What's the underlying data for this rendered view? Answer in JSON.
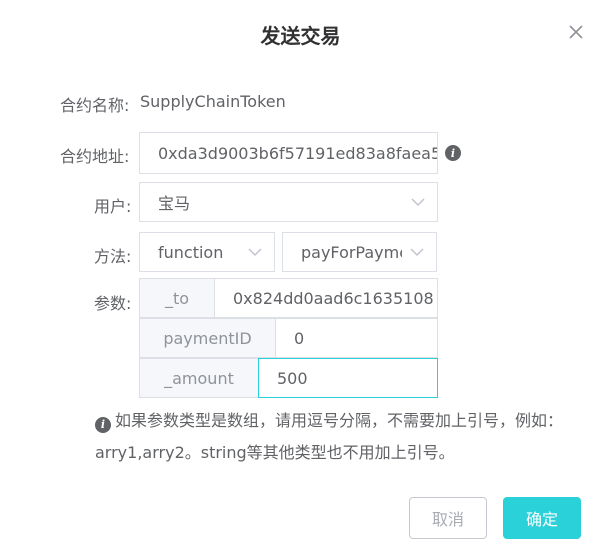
{
  "dialog": {
    "title": "发送交易"
  },
  "contract_name": {
    "label": "合约名称:",
    "value": "SupplyChainToken"
  },
  "contract_address": {
    "label": "合约地址:",
    "value": "0xda3d9003b6f57191ed83a8faea5"
  },
  "user": {
    "label": "用户:",
    "value": "宝马"
  },
  "method": {
    "label": "方法:",
    "type_value": "function",
    "name_value": "payForPayment"
  },
  "params": {
    "label": "参数:",
    "items": [
      {
        "name": "_to",
        "value": "0x824dd0aad6c1635108"
      },
      {
        "name": "paymentID",
        "value": "0"
      },
      {
        "name": "_amount",
        "value": "500"
      }
    ]
  },
  "note": {
    "text": "如果参数类型是数组，请用逗号分隔，不需要加上引号，例如：arry1,arry2。string等其他类型也不用加上引号。"
  },
  "footer": {
    "cancel_label": "取消",
    "confirm_label": "确定"
  },
  "colors": {
    "accent": "#2ad1d8",
    "border": "#dcdfe6",
    "addon_bg": "#f5f7fa"
  },
  "icons": {
    "close": "close-icon",
    "info": "info-icon",
    "chevron": "chevron-down-icon"
  }
}
